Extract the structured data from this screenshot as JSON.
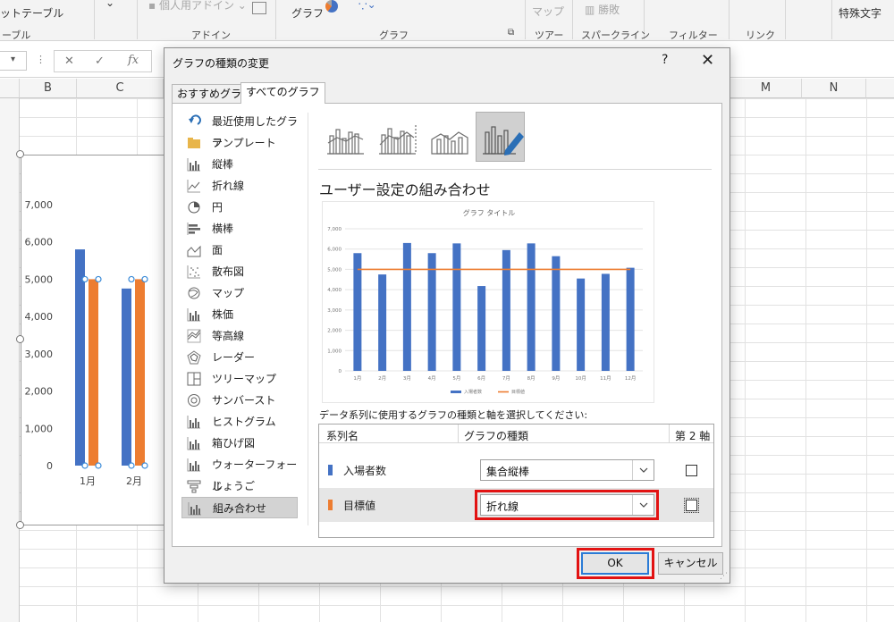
{
  "ribbon": {
    "items": [
      "ットテーブル",
      "個人用アドイン",
      "グラフ",
      "マップ",
      "勝敗",
      "特殊文字"
    ],
    "group_labels": [
      "ーブル",
      "アドイン",
      "グラフ",
      "ツアー",
      "スパークライン",
      "フィルター",
      "リンク"
    ]
  },
  "sheet": {
    "columns": [
      "B",
      "C",
      "M",
      "N"
    ],
    "chart": {
      "y_ticks": [
        "7,000",
        "6,000",
        "5,000",
        "4,000",
        "3,000",
        "2,000",
        "1,000",
        "0"
      ],
      "x_labels": [
        "1月",
        "2月"
      ],
      "colors": {
        "bar": "#4472c4",
        "target": "#ed7d31"
      }
    }
  },
  "dialog": {
    "title": "グラフの種類の変更",
    "help": "?",
    "close": "✕",
    "tabs": [
      "おすすめグラフ",
      "すべてのグラフ"
    ],
    "active_tab": "すべてのグラフ",
    "chart_types": [
      "最近使用したグラフ",
      "テンプレート",
      "縦棒",
      "折れ線",
      "円",
      "横棒",
      "面",
      "散布図",
      "マップ",
      "株価",
      "等高線",
      "レーダー",
      "ツリーマップ",
      "サンバースト",
      "ヒストグラム",
      "箱ひげ図",
      "ウォーターフォール",
      "じょうご",
      "組み合わせ"
    ],
    "chart_type_icons": [
      "undo-icon",
      "folder-icon",
      "column-chart-icon",
      "line-chart-icon",
      "pie-chart-icon",
      "bar-chart-icon",
      "area-chart-icon",
      "scatter-chart-icon",
      "map-chart-icon",
      "stock-chart-icon",
      "surface-chart-icon",
      "radar-chart-icon",
      "treemap-chart-icon",
      "sunburst-chart-icon",
      "histogram-icon",
      "box-whisker-icon",
      "waterfall-icon",
      "funnel-icon",
      "combo-chart-icon"
    ],
    "selected_type": "組み合わせ",
    "section_heading": "ユーザー設定の組み合わせ",
    "series_prompt": "データ系列に使用するグラフの種類と軸を選択してください:",
    "table_headers": {
      "series": "系列名",
      "type": "グラフの種類",
      "secondary": "第 2 軸"
    },
    "series": [
      {
        "name": "入場者数",
        "type": "集合縦棒",
        "secondary_axis": false,
        "color": "#4472c4"
      },
      {
        "name": "目標値",
        "type": "折れ線",
        "secondary_axis": false,
        "color": "#ed7d31"
      }
    ],
    "ok_label": "OK",
    "cancel_label": "キャンセル"
  },
  "chart_data": {
    "type": "bar",
    "title": "グラフ タイトル",
    "categories": [
      "1月",
      "2月",
      "3月",
      "4月",
      "5月",
      "6月",
      "7月",
      "8月",
      "9月",
      "10月",
      "11月",
      "12月"
    ],
    "series": [
      {
        "name": "入場者数",
        "type": "bar",
        "values": [
          5800,
          4750,
          6300,
          5800,
          6280,
          4180,
          5950,
          6280,
          5650,
          4550,
          4780,
          5080
        ]
      },
      {
        "name": "目標値",
        "type": "line",
        "values": [
          5000,
          5000,
          5000,
          5000,
          5000,
          5000,
          5000,
          5000,
          5000,
          5000,
          5000,
          5000
        ]
      }
    ],
    "y_ticks": [
      "7,000",
      "6,000",
      "5,000",
      "4,000",
      "3,000",
      "2,000",
      "1,000",
      "0"
    ],
    "ylim": [
      0,
      7000
    ],
    "legend": "bottom",
    "grid": true
  }
}
